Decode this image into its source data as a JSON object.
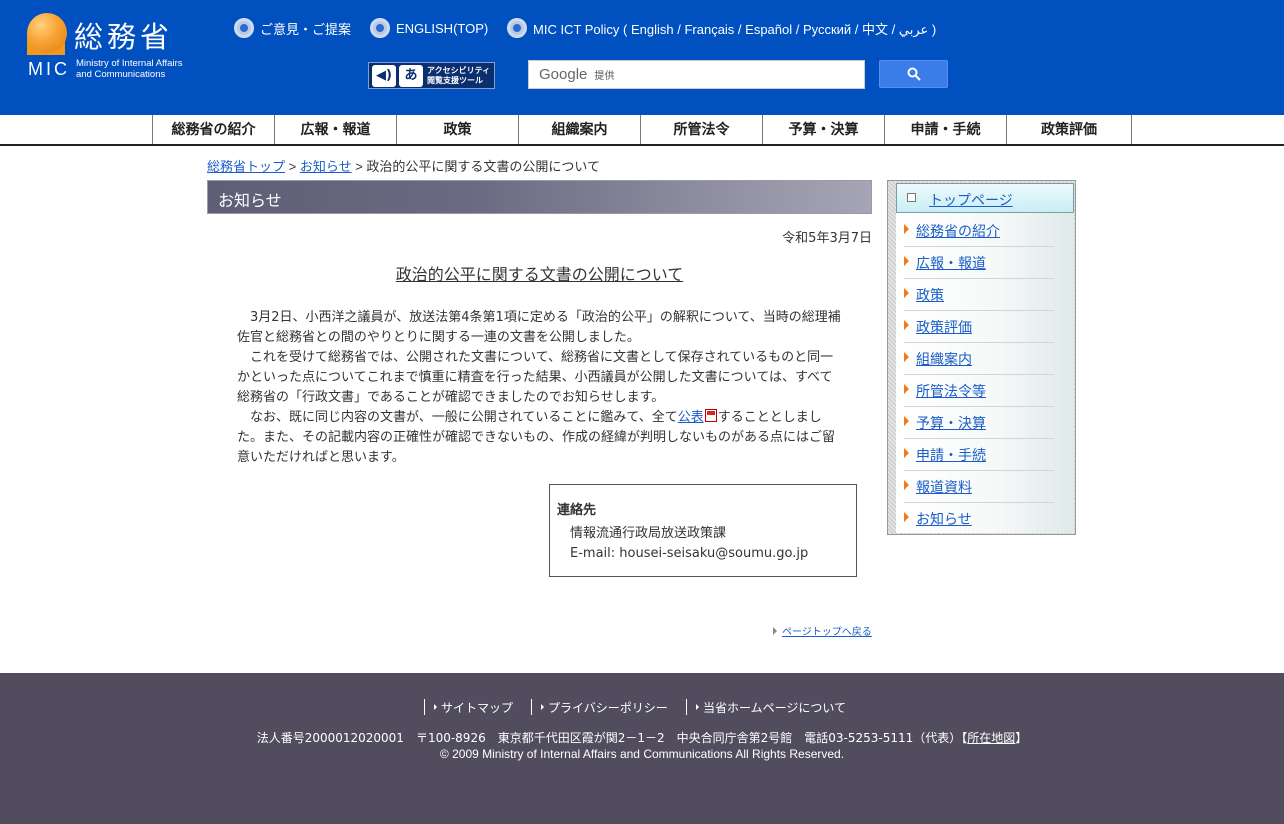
{
  "header": {
    "logo_kanji": "総務省",
    "logo_mic": "MIC",
    "logo_ministry_line1": "Ministry of Internal Affairs",
    "logo_ministry_line2": "and Communications",
    "links": [
      {
        "label": "ご意見・ご提案"
      },
      {
        "label": "ENGLISH(TOP)"
      },
      {
        "label": "MIC ICT Policy ( English / Français / Español / Pусский / 中文 / عربي )"
      }
    ],
    "accessibility_text_line1": "アクセシビリティ",
    "accessibility_text_line2": "閲覧支援ツール",
    "search": {
      "brand": "Google",
      "provided": "提供",
      "placeholder": ""
    }
  },
  "nav": {
    "items": [
      "総務省の紹介",
      "広報・報道",
      "政策",
      "組織案内",
      "所管法令",
      "予算・決算",
      "申請・手続",
      "政策評価"
    ]
  },
  "breadcrumb": {
    "home": "総務省トップ",
    "sep1": " > ",
    "news": "お知らせ",
    "sep2": " > ",
    "current": "政治的公平に関する文書の公開について"
  },
  "section": {
    "title": "お知らせ"
  },
  "article": {
    "date": "令和5年3月7日",
    "title": "政治的公平に関する文書の公開について",
    "para1": "3月2日、小西洋之議員が、放送法第4条第1項に定める「政治的公平」の解釈について、当時の総理補佐官と総務省との間のやりとりに関する一連の文書を公開しました。",
    "para2": "これを受けて総務省では、公開された文書について、総務省に文書として保存されているものと同一かといった点についてこれまで慎重に精査を行った結果、小西議員が公開した文書については、すべて総務省の「行政文書」であることが確認できましたのでお知らせします。",
    "para3_before": "なお、既に同じ内容の文書が、一般に公開されていることに鑑みて、全て",
    "para3_link": "公表",
    "para3_after": "することとしました。また、その記載内容の正確性が確認できないもの、作成の経緯が判明しないものがある点にはご留意いただければと思います。"
  },
  "contact": {
    "heading": "連絡先",
    "dept": "情報流通行政局放送政策課",
    "email": "E-mail: housei-seisaku@soumu.go.jp"
  },
  "pagetop": "ページトップへ戻る",
  "sidebar": {
    "top": "トップページ",
    "items": [
      "総務省の紹介",
      "広報・報道",
      "政策",
      "政策評価",
      "組織案内",
      "所管法令等",
      "予算・決算",
      "申請・手続",
      "報道資料",
      "お知らせ"
    ]
  },
  "footer": {
    "links": [
      "サイトマップ",
      "プライバシーポリシー",
      "当省ホームページについて"
    ],
    "address": "法人番号2000012020001　〒100-8926　東京都千代田区霞が関2－1－2　中央合同庁舎第2号館　電話03-5253-5111（代表）",
    "map_open": "【",
    "map_link": "所在地図",
    "map_close": "】",
    "copyright": "© 2009 Ministry of Internal Affairs and Communications All Rights Reserved."
  }
}
